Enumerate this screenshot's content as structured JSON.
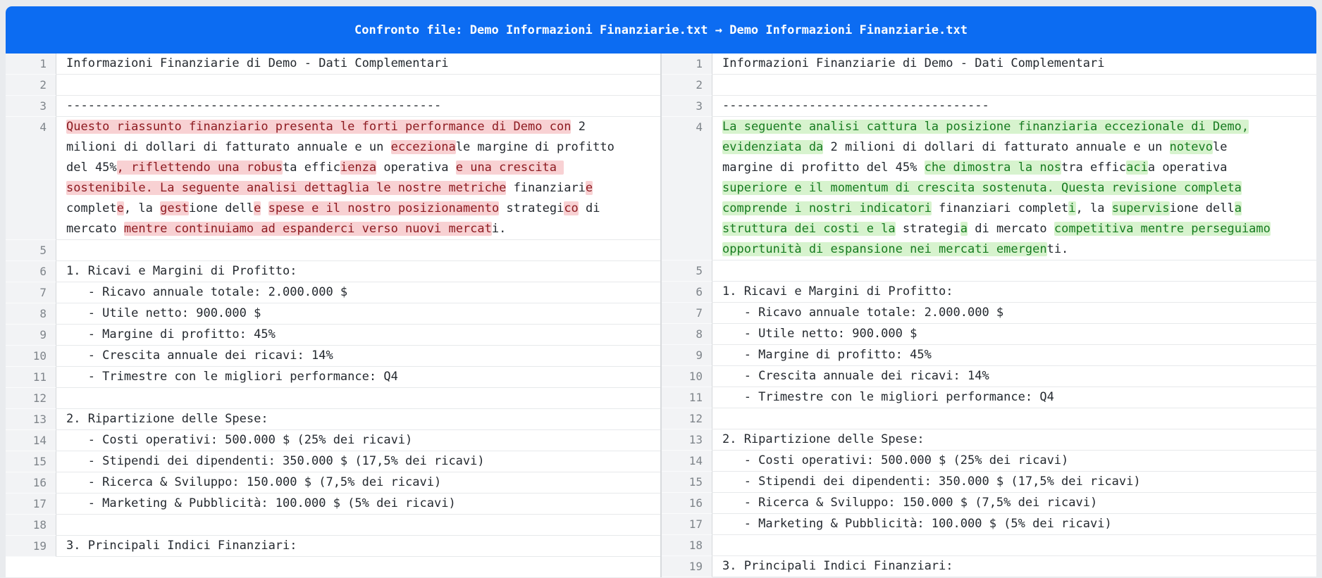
{
  "header": {
    "title": "Confronto file: Demo Informazioni Finanziarie.txt → Demo Informazioni Finanziarie.txt"
  },
  "colors": {
    "header_bg": "#0c6cf2",
    "header_text": "#ffffff",
    "deletion_text": "#8d1b21",
    "deletion_bg": "#f8d1d3",
    "insertion_text": "#177b20",
    "insertion_bg": "#d7f3ce",
    "body_text": "#24292f",
    "line_number_text": "#7f858b",
    "gutter_bg": "#f2f3f5"
  },
  "panes": [
    {
      "id": "left-pane",
      "role": "original-file",
      "lines": [
        {
          "n": 1,
          "rows": [
            [
              {
                "t": "Informazioni Finanziarie di Demo - Dati Complementari",
                "h": "e"
              }
            ]
          ]
        },
        {
          "n": 2,
          "rows": [
            []
          ]
        },
        {
          "n": 3,
          "rows": [
            [
              {
                "t": "----------------------------------------------------",
                "h": "e"
              }
            ]
          ]
        },
        {
          "n": 4,
          "rows": [
            [
              {
                "t": "Questo riassunto finanziario presenta le forti performance di Demo con",
                "h": "d"
              },
              {
                "t": " 2",
                "h": "e"
              }
            ],
            [
              {
                "t": "milioni di dollari di fatturato annuale e un ",
                "h": "e"
              },
              {
                "t": "ecceziona",
                "h": "d"
              },
              {
                "t": "le margine di profitto",
                "h": "e"
              }
            ],
            [
              {
                "t": "del 45%",
                "h": "e"
              },
              {
                "t": ", riflettendo una robus",
                "h": "d"
              },
              {
                "t": "ta effic",
                "h": "e"
              },
              {
                "t": "ienza",
                "h": "d"
              },
              {
                "t": " operativa ",
                "h": "e"
              },
              {
                "t": "e una crescita ",
                "h": "d"
              }
            ],
            [
              {
                "t": "sostenibile. La seguente analisi dettaglia le nostre metriche",
                "h": "d"
              },
              {
                "t": " finanziari",
                "h": "e"
              },
              {
                "t": "e",
                "h": "d"
              }
            ],
            [
              {
                "t": "complet",
                "h": "e"
              },
              {
                "t": "e",
                "h": "d"
              },
              {
                "t": ", la ",
                "h": "e"
              },
              {
                "t": "gest",
                "h": "d"
              },
              {
                "t": "ione dell",
                "h": "e"
              },
              {
                "t": "e",
                "h": "d"
              },
              {
                "t": " ",
                "h": "e"
              },
              {
                "t": "spese e il nostro posizionamento",
                "h": "d"
              },
              {
                "t": " strategi",
                "h": "e"
              },
              {
                "t": "co",
                "h": "d"
              },
              {
                "t": " di",
                "h": "e"
              }
            ],
            [
              {
                "t": "mercato ",
                "h": "e"
              },
              {
                "t": "mentre continuiamo ad espanderci verso nuovi mercat",
                "h": "d"
              },
              {
                "t": "i.",
                "h": "e"
              }
            ]
          ]
        },
        {
          "n": 5,
          "rows": [
            []
          ]
        },
        {
          "n": 6,
          "rows": [
            [
              {
                "t": "1. Ricavi e Margini di Profitto:",
                "h": "e"
              }
            ]
          ]
        },
        {
          "n": 7,
          "rows": [
            [
              {
                "t": "   - Ricavo annuale totale: 2.000.000 $",
                "h": "e"
              }
            ]
          ]
        },
        {
          "n": 8,
          "rows": [
            [
              {
                "t": "   - Utile netto: 900.000 $",
                "h": "e"
              }
            ]
          ]
        },
        {
          "n": 9,
          "rows": [
            [
              {
                "t": "   - Margine di profitto: 45%",
                "h": "e"
              }
            ]
          ]
        },
        {
          "n": 10,
          "rows": [
            [
              {
                "t": "   - Crescita annuale dei ricavi: 14%",
                "h": "e"
              }
            ]
          ]
        },
        {
          "n": 11,
          "rows": [
            [
              {
                "t": "   - Trimestre con le migliori performance: Q4",
                "h": "e"
              }
            ]
          ]
        },
        {
          "n": 12,
          "rows": [
            []
          ]
        },
        {
          "n": 13,
          "rows": [
            [
              {
                "t": "2. Ripartizione delle Spese:",
                "h": "e"
              }
            ]
          ]
        },
        {
          "n": 14,
          "rows": [
            [
              {
                "t": "   - Costi operativi: 500.000 $ (25% dei ricavi)",
                "h": "e"
              }
            ]
          ]
        },
        {
          "n": 15,
          "rows": [
            [
              {
                "t": "   - Stipendi dei dipendenti: 350.000 $ (17,5% dei ricavi)",
                "h": "e"
              }
            ]
          ]
        },
        {
          "n": 16,
          "rows": [
            [
              {
                "t": "   - Ricerca & Sviluppo: 150.000 $ (7,5% dei ricavi)",
                "h": "e"
              }
            ]
          ]
        },
        {
          "n": 17,
          "rows": [
            [
              {
                "t": "   - Marketing & Pubblicità: 100.000 $ (5% dei ricavi)",
                "h": "e"
              }
            ]
          ]
        },
        {
          "n": 18,
          "rows": [
            []
          ]
        },
        {
          "n": 19,
          "rows": [
            [
              {
                "t": "3. Principali Indici Finanziari:",
                "h": "e"
              }
            ]
          ]
        }
      ]
    },
    {
      "id": "right-pane",
      "role": "modified-file",
      "lines": [
        {
          "n": 1,
          "rows": [
            [
              {
                "t": "Informazioni Finanziarie di Demo - Dati Complementari",
                "h": "e"
              }
            ]
          ]
        },
        {
          "n": 2,
          "rows": [
            []
          ]
        },
        {
          "n": 3,
          "rows": [
            [
              {
                "t": "-------------------------------------",
                "h": "e"
              }
            ]
          ]
        },
        {
          "n": 4,
          "rows": [
            [
              {
                "t": "La seguente analisi cattura la posizione finanziaria eccezionale di Demo,",
                "h": "i"
              }
            ],
            [
              {
                "t": "evidenziata da",
                "h": "i"
              },
              {
                "t": " 2 milioni di dollari di fatturato annuale e un ",
                "h": "e"
              },
              {
                "t": "notevo",
                "h": "i"
              },
              {
                "t": "le",
                "h": "e"
              }
            ],
            [
              {
                "t": "margine di profitto del 45% ",
                "h": "e"
              },
              {
                "t": "che dimostra la nos",
                "h": "i"
              },
              {
                "t": "tra effic",
                "h": "e"
              },
              {
                "t": "aci",
                "h": "i"
              },
              {
                "t": "a operativa",
                "h": "e"
              }
            ],
            [
              {
                "t": "superiore e il momentum di crescita sostenuta. Questa revisione completa",
                "h": "i"
              }
            ],
            [
              {
                "t": "comprende i nostri indicatori",
                "h": "i"
              },
              {
                "t": " finanziari complet",
                "h": "e"
              },
              {
                "t": "i",
                "h": "i"
              },
              {
                "t": ", la ",
                "h": "e"
              },
              {
                "t": "supervis",
                "h": "i"
              },
              {
                "t": "ione dell",
                "h": "e"
              },
              {
                "t": "a",
                "h": "i"
              }
            ],
            [
              {
                "t": "struttura dei costi e la",
                "h": "i"
              },
              {
                "t": " strategi",
                "h": "e"
              },
              {
                "t": "a",
                "h": "i"
              },
              {
                "t": " di mercato ",
                "h": "e"
              },
              {
                "t": "competitiva mentre perseguiamo",
                "h": "i"
              }
            ],
            [
              {
                "t": "opportunità di espansione nei mercati emergen",
                "h": "i"
              },
              {
                "t": "ti.",
                "h": "e"
              }
            ]
          ]
        },
        {
          "n": 5,
          "rows": [
            []
          ]
        },
        {
          "n": 6,
          "rows": [
            [
              {
                "t": "1. Ricavi e Margini di Profitto:",
                "h": "e"
              }
            ]
          ]
        },
        {
          "n": 7,
          "rows": [
            [
              {
                "t": "   - Ricavo annuale totale: 2.000.000 $",
                "h": "e"
              }
            ]
          ]
        },
        {
          "n": 8,
          "rows": [
            [
              {
                "t": "   - Utile netto: 900.000 $",
                "h": "e"
              }
            ]
          ]
        },
        {
          "n": 9,
          "rows": [
            [
              {
                "t": "   - Margine di profitto: 45%",
                "h": "e"
              }
            ]
          ]
        },
        {
          "n": 10,
          "rows": [
            [
              {
                "t": "   - Crescita annuale dei ricavi: 14%",
                "h": "e"
              }
            ]
          ]
        },
        {
          "n": 11,
          "rows": [
            [
              {
                "t": "   - Trimestre con le migliori performance: Q4",
                "h": "e"
              }
            ]
          ]
        },
        {
          "n": 12,
          "rows": [
            []
          ]
        },
        {
          "n": 13,
          "rows": [
            [
              {
                "t": "2. Ripartizione delle Spese:",
                "h": "e"
              }
            ]
          ]
        },
        {
          "n": 14,
          "rows": [
            [
              {
                "t": "   - Costi operativi: 500.000 $ (25% dei ricavi)",
                "h": "e"
              }
            ]
          ]
        },
        {
          "n": 15,
          "rows": [
            [
              {
                "t": "   - Stipendi dei dipendenti: 350.000 $ (17,5% dei ricavi)",
                "h": "e"
              }
            ]
          ]
        },
        {
          "n": 16,
          "rows": [
            [
              {
                "t": "   - Ricerca & Sviluppo: 150.000 $ (7,5% dei ricavi)",
                "h": "e"
              }
            ]
          ]
        },
        {
          "n": 17,
          "rows": [
            [
              {
                "t": "   - Marketing & Pubblicità: 100.000 $ (5% dei ricavi)",
                "h": "e"
              }
            ]
          ]
        },
        {
          "n": 18,
          "rows": [
            []
          ]
        },
        {
          "n": 19,
          "rows": [
            [
              {
                "t": "3. Principali Indici Finanziari:",
                "h": "e"
              }
            ]
          ]
        }
      ]
    }
  ]
}
